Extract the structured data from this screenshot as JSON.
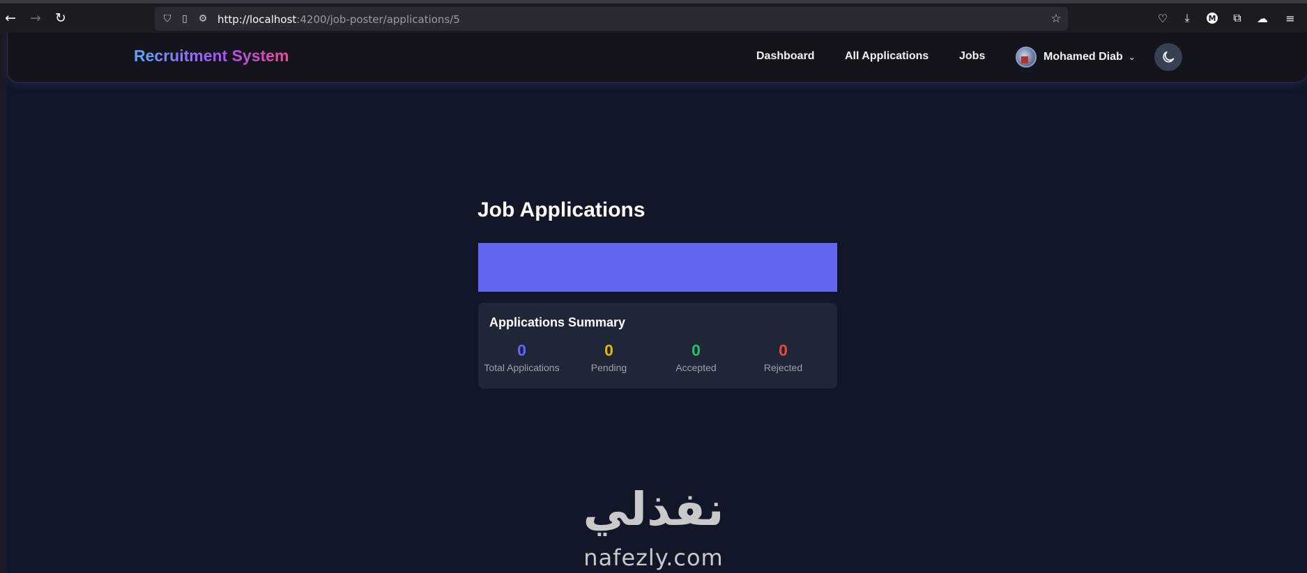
{
  "browser": {
    "url_host": "http://localhost",
    "url_path": ":4200/job-poster/applications/5",
    "icons": [
      "back-icon",
      "forward-icon",
      "reload-icon",
      "shield-icon",
      "page-icon",
      "permissions-icon",
      "bookmark-star-icon",
      "pocket-icon",
      "download-icon",
      "account-icon",
      "extensions-icon",
      "extension-icon",
      "menu-icon"
    ],
    "account_badge": "M"
  },
  "navbar": {
    "brand": "Recruitment System",
    "links": [
      "Dashboard",
      "All Applications",
      "Jobs"
    ],
    "user_name": "Mohamed Diab",
    "theme_toggle_icon": "moon-icon"
  },
  "main": {
    "title": "Job Applications",
    "banner_color": "#6366f1",
    "summary": {
      "title": "Applications Summary",
      "stats": [
        {
          "value": "0",
          "label": "Total Applications",
          "color": "#6366f1"
        },
        {
          "value": "0",
          "label": "Pending",
          "color": "#eab308"
        },
        {
          "value": "0",
          "label": "Accepted",
          "color": "#22c55e"
        },
        {
          "value": "0",
          "label": "Rejected",
          "color": "#ef4444"
        }
      ]
    }
  },
  "watermark": {
    "arabic": "نفذلي",
    "latin": "nafezly.com"
  }
}
